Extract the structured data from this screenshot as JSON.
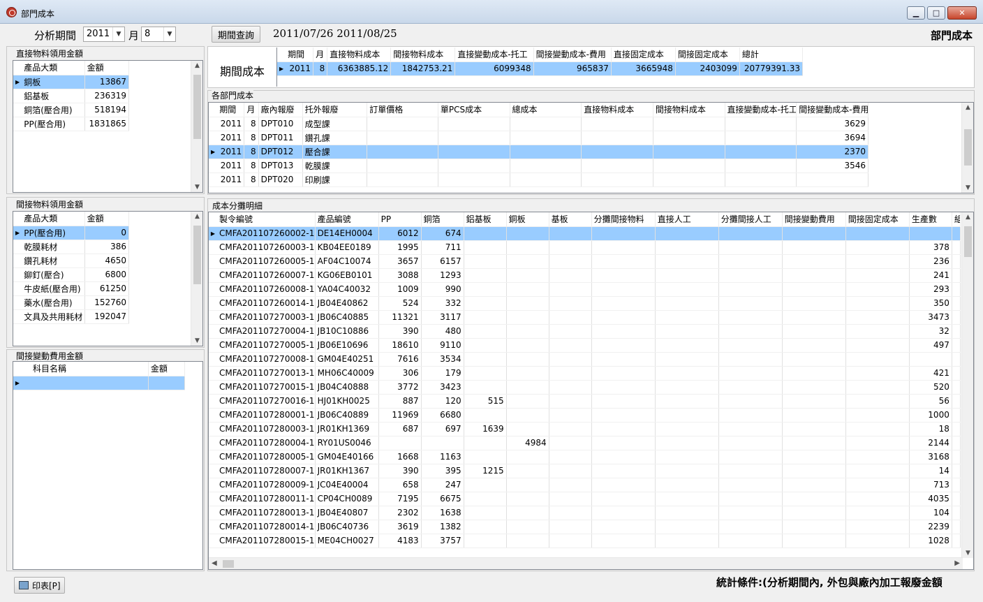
{
  "window": {
    "title": "部門成本"
  },
  "toolbar": {
    "period_label": "分析期間",
    "year": "2011",
    "month_label": "月",
    "month": "8",
    "query_button": "期間查詢",
    "date_range": "2011/07/26 2011/08/25",
    "page_title": "部門成本"
  },
  "direct_material": {
    "title": "直接物料領用金額",
    "headers": [
      "產品大類",
      "金額"
    ],
    "rows": [
      [
        "銅板",
        "13867"
      ],
      [
        "鋁基板",
        "236319"
      ],
      [
        "銅箔(壓合用)",
        "518194"
      ],
      [
        "PP(壓合用)",
        "1831865"
      ]
    ]
  },
  "indirect_material": {
    "title": "間接物料領用金額",
    "headers": [
      "產品大類",
      "金額"
    ],
    "rows": [
      [
        "PP(壓合用)",
        "0"
      ],
      [
        "乾膜耗材",
        "386"
      ],
      [
        "鑽孔耗材",
        "4650"
      ],
      [
        "鉚釘(壓合)",
        "6800"
      ],
      [
        "牛皮紙(壓合用)",
        "61250"
      ],
      [
        "藥水(壓合用)",
        "152760"
      ],
      [
        "文具及共用耗材",
        "192047"
      ]
    ]
  },
  "indirect_variable": {
    "title": "間接變動費用金額",
    "headers": [
      "科目名稱",
      "金額"
    ]
  },
  "period_cost": {
    "label": "期間成本",
    "headers": [
      "期間",
      "月",
      "直接物料成本",
      "間接物料成本",
      "直接變動成本-托工",
      "間接變動成本-費用",
      "直接固定成本",
      "間接固定成本",
      "總計"
    ],
    "row": [
      "2011",
      "8",
      "6363885.12",
      "1842753.21",
      "6099348",
      "965837",
      "3665948",
      "2403099",
      "20779391.33"
    ]
  },
  "dept_cost": {
    "title": "各部門成本",
    "headers": [
      "期間",
      "月",
      "廠內報廢",
      "托外報廢",
      "訂單價格",
      "單PCS成本",
      "總成本",
      "直接物料成本",
      "間接物料成本",
      "直接變動成本-托工",
      "間接變動成本-費用"
    ],
    "rows": [
      [
        "2011",
        "8",
        "DPT010",
        "成型課",
        "3629"
      ],
      [
        "2011",
        "8",
        "DPT011",
        "鑽孔課",
        "3694"
      ],
      [
        "2011",
        "8",
        "DPT012",
        "壓合課",
        "2370"
      ],
      [
        "2011",
        "8",
        "DPT013",
        "乾膜課",
        "3546"
      ],
      [
        "2011",
        "8",
        "DPT020",
        "印刷課",
        ""
      ]
    ]
  },
  "allocation": {
    "title": "成本分攤明細",
    "headers": [
      "製令編號",
      "產品編號",
      "PP",
      "銅箔",
      "鋁基板",
      "銅板",
      "基板",
      "分攤間接物料",
      "直接人工",
      "分攤間接人工",
      "間接變動費用",
      "間接固定成本",
      "生產數",
      "組"
    ],
    "rows": [
      [
        "CMFA201107260002-1",
        "DE14EH0004",
        "6012",
        "674",
        "",
        "",
        ""
      ],
      [
        "CMFA201107260003-1",
        "KB04EE0189",
        "1995",
        "711",
        "",
        "",
        "378"
      ],
      [
        "CMFA201107260005-1",
        "AF04C10074",
        "3657",
        "6157",
        "",
        "",
        "236"
      ],
      [
        "CMFA201107260007-1",
        "KG06EB0101",
        "3088",
        "1293",
        "",
        "",
        "241"
      ],
      [
        "CMFA201107260008-1",
        "YA04C40032",
        "1009",
        "990",
        "",
        "",
        "293"
      ],
      [
        "CMFA201107260014-1",
        "JB04E40862",
        "524",
        "332",
        "",
        "",
        "350"
      ],
      [
        "CMFA201107270003-1",
        "JB06C40885",
        "11321",
        "3117",
        "",
        "",
        "3473"
      ],
      [
        "CMFA201107270004-1",
        "JB10C10886",
        "390",
        "480",
        "",
        "",
        "32"
      ],
      [
        "CMFA201107270005-1",
        "JB06E10696",
        "18610",
        "9110",
        "",
        "",
        "497"
      ],
      [
        "CMFA201107270008-1",
        "GM04E40251",
        "7616",
        "3534",
        "",
        "",
        ""
      ],
      [
        "CMFA201107270013-1",
        "MH06C40009",
        "306",
        "179",
        "",
        "",
        "421"
      ],
      [
        "CMFA201107270015-1",
        "JB04C40888",
        "3772",
        "3423",
        "",
        "",
        "520"
      ],
      [
        "CMFA201107270016-1",
        "HJ01KH0025",
        "887",
        "120",
        "515",
        "",
        "56"
      ],
      [
        "CMFA201107280001-1",
        "JB06C40889",
        "11969",
        "6680",
        "",
        "",
        "1000"
      ],
      [
        "CMFA201107280003-1",
        "JR01KH1369",
        "687",
        "697",
        "1639",
        "",
        "18"
      ],
      [
        "CMFA201107280004-1",
        "RY01US0046",
        "",
        "",
        "",
        "4984",
        "2144"
      ],
      [
        "CMFA201107280005-1",
        "GM04E40166",
        "1668",
        "1163",
        "",
        "",
        "3168"
      ],
      [
        "CMFA201107280007-1",
        "JR01KH1367",
        "390",
        "395",
        "1215",
        "",
        "14"
      ],
      [
        "CMFA201107280009-1",
        "JC04E40004",
        "658",
        "247",
        "",
        "",
        "713"
      ],
      [
        "CMFA201107280011-1",
        "CP04CH0089",
        "7195",
        "6675",
        "",
        "",
        "4035"
      ],
      [
        "CMFA201107280013-1",
        "JB04E40807",
        "2302",
        "1638",
        "",
        "",
        "104"
      ],
      [
        "CMFA201107280014-1",
        "JB06C40736",
        "3619",
        "1382",
        "",
        "",
        "2239"
      ],
      [
        "CMFA201107280015-1",
        "ME04CH0027",
        "4183",
        "3757",
        "",
        "",
        "1028"
      ]
    ]
  },
  "footer": {
    "print_button": "印表[P]",
    "condition": "統計條件:(分析期間內, 外包與廠內加工報廢金額"
  }
}
